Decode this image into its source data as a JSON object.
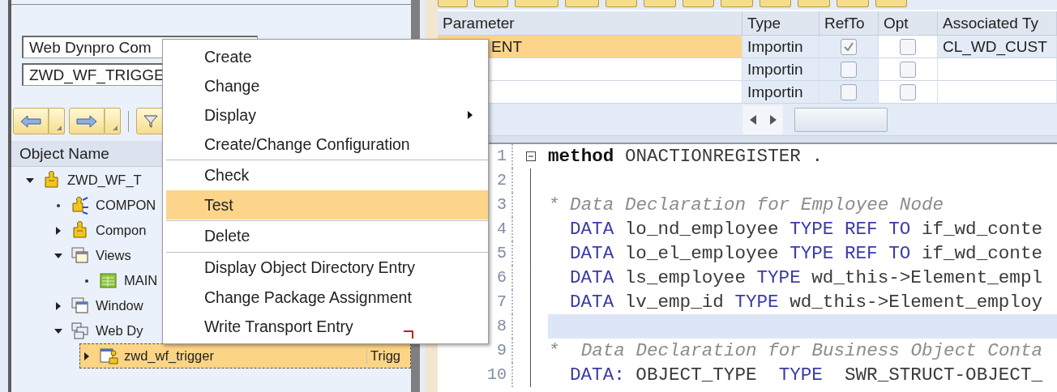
{
  "left_panel": {
    "fields": [
      {
        "value": "Web Dynpro Com"
      },
      {
        "value": "ZWD_WF_TRIGGE"
      }
    ],
    "tree": {
      "column_1": "Object Name",
      "nodes": [
        {
          "label": "ZWD_WF_T",
          "kind": "component",
          "expanded": true,
          "selected": false,
          "children": [
            {
              "label": "COMPON",
              "kind": "controller",
              "selected": false
            },
            {
              "label": "Compon",
              "kind": "component",
              "expanded": false,
              "selected": false
            },
            {
              "label": "Views",
              "kind": "views",
              "expanded": true,
              "selected": false,
              "children": [
                {
                  "label": "MAIN",
                  "kind": "view",
                  "selected": false
                }
              ]
            },
            {
              "label": "Window",
              "kind": "windows",
              "expanded": false,
              "selected": false
            },
            {
              "label": "Web Dy",
              "kind": "app",
              "expanded": true,
              "selected": false,
              "children": [
                {
                  "label": "zwd_wf_trigger",
                  "column_2": "Trigg",
                  "kind": "webapp",
                  "expanded": false,
                  "selected": true
                }
              ]
            }
          ]
        }
      ]
    }
  },
  "context_menu": {
    "items": [
      {
        "label": "Create",
        "separator_before": false,
        "submenu": false,
        "selected": false
      },
      {
        "label": "Change",
        "separator_before": false,
        "submenu": false,
        "selected": false
      },
      {
        "label": "Display",
        "separator_before": false,
        "submenu": true,
        "selected": false
      },
      {
        "label": "Create/Change Configuration",
        "separator_before": false,
        "submenu": false,
        "selected": false
      },
      {
        "label": "Check",
        "separator_before": true,
        "submenu": false,
        "selected": false
      },
      {
        "label": "Test",
        "separator_before": false,
        "submenu": false,
        "selected": true
      },
      {
        "label": "Delete",
        "separator_before": true,
        "submenu": false,
        "selected": false
      },
      {
        "label": "Display Object Directory Entry",
        "separator_before": true,
        "submenu": false,
        "selected": false
      },
      {
        "label": "Change Package Assignment",
        "separator_before": false,
        "submenu": false,
        "selected": false
      },
      {
        "label": "Write Transport Entry",
        "separator_before": false,
        "submenu": false,
        "selected": false
      }
    ]
  },
  "parameters_table": {
    "columns": [
      "Parameter",
      "Type",
      "RefTo",
      "Opt",
      "Associated Ty"
    ],
    "rows": [
      {
        "parameter": "ENT",
        "type": "Importin",
        "refto": true,
        "opt": false,
        "associated_type": "CL_WD_CUST",
        "selected": true
      },
      {
        "type": "Importin",
        "refto": false,
        "opt": false,
        "selected": false
      },
      {
        "type": "Importin",
        "refto": false,
        "opt": false,
        "selected": false
      }
    ]
  },
  "code_editor": {
    "lines": [
      {
        "number": "1",
        "fold_start": true,
        "indented": false,
        "current": false,
        "tokens": [
          {
            "kind": "bold",
            "text": "method"
          },
          {
            "kind": "plain",
            "text": " ONACTIONREGISTER ."
          }
        ]
      },
      {
        "number": "2",
        "fold_start": false,
        "current": false
      },
      {
        "number": "3",
        "fold_start": false,
        "indented": false,
        "current": false,
        "tokens": [
          {
            "kind": "comment",
            "text": "* Data Declaration for Employee Node"
          }
        ]
      },
      {
        "number": "4",
        "fold_start": false,
        "indented": true,
        "current": false,
        "tokens": [
          {
            "kind": "keyword",
            "text": "DATA"
          },
          {
            "kind": "plain",
            "text": " lo_nd_employee "
          },
          {
            "kind": "keyword",
            "text": "TYPE REF TO"
          },
          {
            "kind": "plain",
            "text": " if_wd_conte"
          }
        ]
      },
      {
        "number": "5",
        "fold_start": false,
        "indented": true,
        "current": false,
        "tokens": [
          {
            "kind": "keyword",
            "text": "DATA"
          },
          {
            "kind": "plain",
            "text": " lo_el_employee "
          },
          {
            "kind": "keyword",
            "text": "TYPE REF TO"
          },
          {
            "kind": "plain",
            "text": " if_wd_conte"
          }
        ]
      },
      {
        "number": "6",
        "fold_start": false,
        "indented": true,
        "current": false,
        "tokens": [
          {
            "kind": "keyword",
            "text": "DATA"
          },
          {
            "kind": "plain",
            "text": " ls_employee "
          },
          {
            "kind": "keyword",
            "text": "TYPE"
          },
          {
            "kind": "plain",
            "text": " wd_this->Element_empl"
          }
        ]
      },
      {
        "number": "7",
        "fold_start": false,
        "indented": true,
        "current": false,
        "tokens": [
          {
            "kind": "keyword",
            "text": "DATA"
          },
          {
            "kind": "plain",
            "text": " lv_emp_id "
          },
          {
            "kind": "keyword",
            "text": "TYPE"
          },
          {
            "kind": "plain",
            "text": " wd_this->Element_employ"
          }
        ]
      },
      {
        "number": "8",
        "fold_start": false,
        "current": true
      },
      {
        "number": "9",
        "fold_start": false,
        "indented": false,
        "current": false,
        "tokens": [
          {
            "kind": "comment",
            "text": "*  Data Declaration for Business Object Conta"
          }
        ]
      },
      {
        "number": "10",
        "fold_start": false,
        "indented": true,
        "current": false,
        "tokens": [
          {
            "kind": "keyword",
            "text": "DATA:"
          },
          {
            "kind": "plain",
            "text": " OBJECT_TYPE  "
          },
          {
            "kind": "keyword",
            "text": "TYPE"
          },
          {
            "kind": "plain",
            "text": "  SWR_STRUCT-OBJECT_"
          }
        ]
      }
    ]
  }
}
